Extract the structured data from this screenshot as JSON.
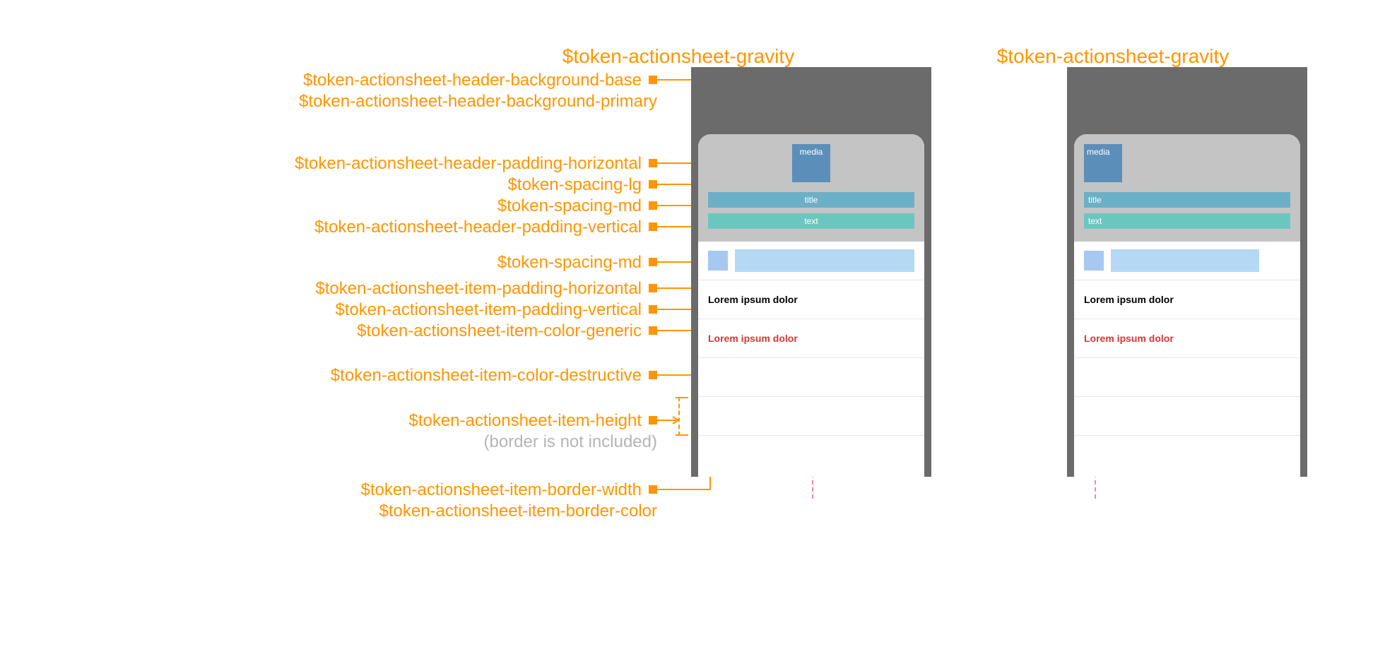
{
  "gravity_label": "$token-actionsheet-gravity",
  "tokens": {
    "header_bg_base": "$token-actionsheet-header-background-base",
    "header_bg_primary": "$token-actionsheet-header-background-primary",
    "header_pad_h": "$token-actionsheet-header-padding-horizontal",
    "spacing_lg": "$token-spacing-lg",
    "spacing_md": "$token-spacing-md",
    "header_pad_v": "$token-actionsheet-header-padding-vertical",
    "spacing_md2": "$token-spacing-md",
    "item_pad_h": "$token-actionsheet-item-padding-horizontal",
    "item_pad_v": "$token-actionsheet-item-padding-vertical",
    "item_color_generic": "$token-actionsheet-item-color-generic",
    "item_color_destructive": "$token-actionsheet-item-color-destructive",
    "item_height": "$token-actionsheet-item-height",
    "item_height_note": "(border is not included)",
    "item_border_width": "$token-actionsheet-item-border-width",
    "item_border_color": "$token-actionsheet-item-border-color"
  },
  "mockup": {
    "media_label": "media",
    "title_label": "title",
    "text_label": "text",
    "generic_item": "Lorem ipsum dolor",
    "destructive_item": "Lorem ipsum dolor"
  },
  "colors": {
    "accent": "#ff9500",
    "frame": "#6b6b6b",
    "header": "#c4c4c4",
    "media": "#5b8fb9",
    "title": "#6bb0c6",
    "text": "#6cc6c0",
    "icon_ph": "#a7c8f0",
    "text_ph": "#b5d9f4",
    "destructive": "#d63636",
    "gravity_line": "#f28aa0",
    "note_grey": "#b5b5b5",
    "border": "#e6e6e6"
  }
}
